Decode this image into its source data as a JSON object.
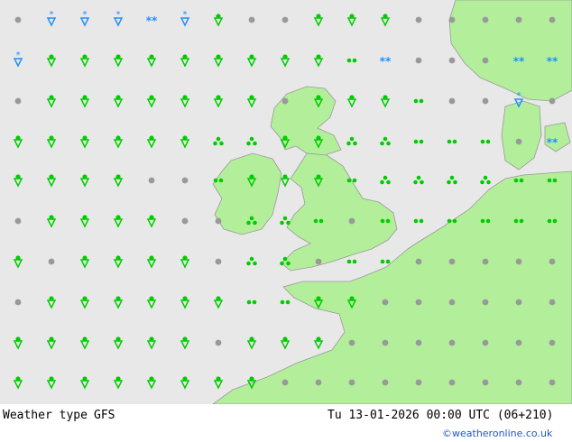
{
  "footer": {
    "title": "Weather type",
    "model": "GFS",
    "valid_time": "Tu 13-01-2026 00:00 UTC (06+210)",
    "credit": "©weatheronline.co.uk"
  },
  "colors": {
    "sea": "#e8e8e8",
    "land": "#b3ee9a",
    "coast": "#9a9a9a",
    "rain": "#00cc00",
    "snow": "#1e90ff",
    "cloud": "#999999"
  },
  "grid": {
    "x": [
      20,
      57,
      94,
      131,
      168,
      205,
      242,
      279,
      316,
      353,
      390,
      427,
      464,
      501,
      538,
      575,
      612
    ],
    "y": [
      22,
      67,
      112,
      157,
      200,
      245,
      290,
      335,
      380,
      424
    ]
  },
  "symbols": [
    [
      "c",
      "s",
      "s",
      "s",
      "S",
      "s",
      "r",
      "c",
      "c",
      "r",
      "r",
      "r",
      "c",
      "c",
      "c",
      "c",
      "c"
    ],
    [
      "s",
      "r",
      "r",
      "r",
      "r",
      "r",
      "r",
      "r",
      "r",
      "r",
      "d",
      "S",
      "c",
      "c",
      "c",
      "S",
      "S"
    ],
    [
      "c",
      "r",
      "r",
      "r",
      "r",
      "r",
      "r",
      "r",
      "c",
      "r",
      "r",
      "r",
      "d",
      "c",
      "c",
      "s",
      "c"
    ],
    [
      "r",
      "r",
      "r",
      "r",
      "r",
      "r",
      "t",
      "t",
      "r",
      "r",
      "t",
      "t",
      "d",
      "d",
      "d",
      "c",
      "S"
    ],
    [
      "r",
      "r",
      "r",
      "r",
      "c",
      "c",
      "d",
      "r",
      "r",
      "r",
      "d",
      "t",
      "t",
      "t",
      "t",
      "d",
      "d"
    ],
    [
      "c",
      "r",
      "r",
      "r",
      "r",
      "c",
      "c",
      "t",
      "t",
      "d",
      "c",
      "d",
      "d",
      "d",
      "d",
      "d",
      "d"
    ],
    [
      "r",
      "c",
      "r",
      "r",
      "r",
      "r",
      "c",
      "t",
      "t",
      "c",
      "d",
      "d",
      "c",
      "c",
      "c",
      "c",
      "c"
    ],
    [
      "c",
      "r",
      "r",
      "r",
      "r",
      "r",
      "r",
      "d",
      "d",
      "r",
      "r",
      "c",
      "c",
      "c",
      "c",
      "c",
      "c"
    ],
    [
      "r",
      "r",
      "r",
      "r",
      "r",
      "r",
      "c",
      "r",
      "r",
      "r",
      "c",
      "c",
      "c",
      "c",
      "c",
      "c",
      "c"
    ],
    [
      "r",
      "r",
      "r",
      "r",
      "r",
      "r",
      "r",
      "r",
      "c",
      "c",
      "c",
      "c",
      "c",
      "c",
      "c",
      "c",
      "c"
    ]
  ]
}
